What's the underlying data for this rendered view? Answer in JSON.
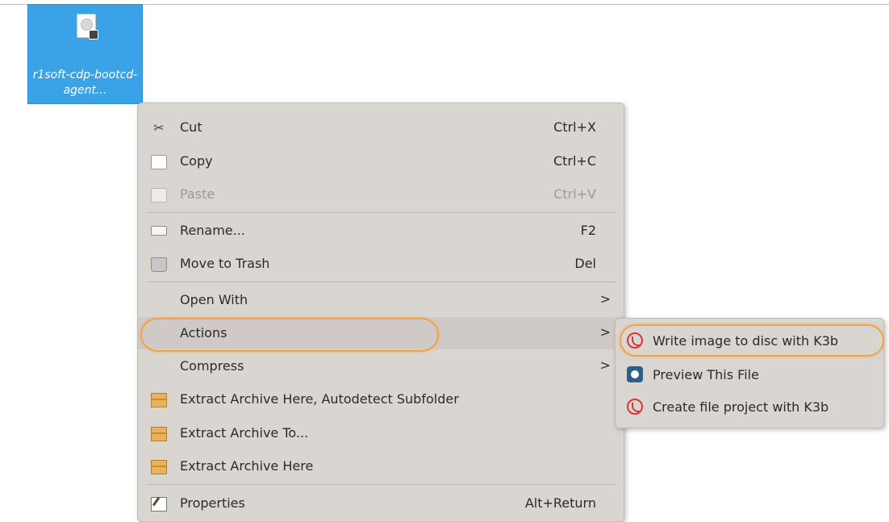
{
  "desktop": {
    "file_label": "r1soft-cdp-bootcd-agent..."
  },
  "context_menu": {
    "items": [
      {
        "label": "Cut",
        "shortcut": "Ctrl+X",
        "icon": "scissors-icon"
      },
      {
        "label": "Copy",
        "shortcut": "Ctrl+C",
        "icon": "copy-icon"
      },
      {
        "label": "Paste",
        "shortcut": "Ctrl+V",
        "icon": "paste-icon",
        "disabled": true
      },
      {
        "label": "Rename...",
        "shortcut": "F2",
        "icon": "rename-icon"
      },
      {
        "label": "Move to Trash",
        "shortcut": "Del",
        "icon": "trash-icon"
      },
      {
        "label": "Open With",
        "submenu_arrow": ">"
      },
      {
        "label": "Actions",
        "submenu_arrow": ">",
        "highlighted": true
      },
      {
        "label": "Compress",
        "submenu_arrow": ">"
      },
      {
        "label": "Extract Archive Here, Autodetect Subfolder",
        "icon": "archive-icon"
      },
      {
        "label": "Extract Archive To...",
        "icon": "archive-icon"
      },
      {
        "label": "Extract Archive Here",
        "icon": "archive-icon"
      },
      {
        "label": "Properties",
        "shortcut": "Alt+Return",
        "icon": "properties-icon"
      }
    ]
  },
  "actions_submenu": {
    "items": [
      {
        "label": "Write image to disc with K3b",
        "icon": "k3b-icon",
        "highlighted": true
      },
      {
        "label": "Preview This File",
        "icon": "preview-icon"
      },
      {
        "label": "Create file project with K3b",
        "icon": "k3b-icon"
      }
    ]
  },
  "colors": {
    "selection_blue": "#3aa3e8",
    "menu_bg": "#d9d5d1",
    "highlight_oval": "#f0a44a",
    "disabled_text": "#9d9a97"
  }
}
